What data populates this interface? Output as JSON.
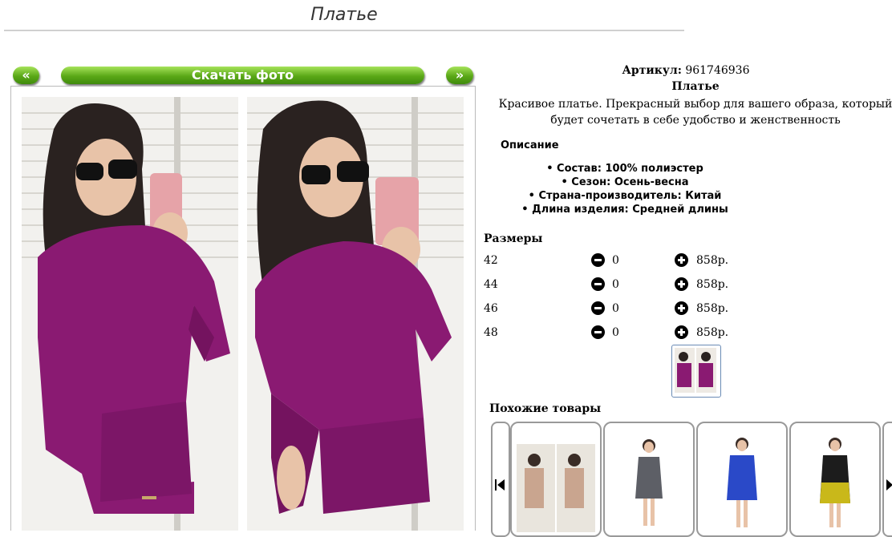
{
  "page": {
    "title": "Платье"
  },
  "gallery": {
    "prev_label": "«",
    "download_label": "Скачать фото",
    "next_label": "»"
  },
  "product": {
    "sku_label": "Артикул:",
    "sku_value": "961746936",
    "name": "Платье",
    "description": "Красивое платье. Прекрасный выбор для вашего образа, который будет сочетать в себе удобство и женственность",
    "details_heading": "Описание",
    "features": [
      "Состав: 100% полиэстер",
      "Сезон: Осень-весна",
      "Страна-производитель: Китай",
      "Длина изделия: Средней длины"
    ]
  },
  "sizes": {
    "heading": "Размеры",
    "rows": [
      {
        "size": "42",
        "qty": "0",
        "price": "858р."
      },
      {
        "size": "44",
        "qty": "0",
        "price": "858р."
      },
      {
        "size": "46",
        "qty": "0",
        "price": "858р."
      },
      {
        "size": "48",
        "qty": "0",
        "price": "858р."
      }
    ]
  },
  "similar": {
    "heading": "Похожие товары"
  },
  "colors": {
    "accent_green": "#5aa817",
    "dress_purple": "#8a1a72",
    "thumb_border": "#6a8bb5"
  },
  "icons": {
    "minus": "minus-circle-icon",
    "plus": "plus-circle-icon",
    "carousel_prev": "skip-back-icon",
    "carousel_next": "skip-forward-icon"
  }
}
